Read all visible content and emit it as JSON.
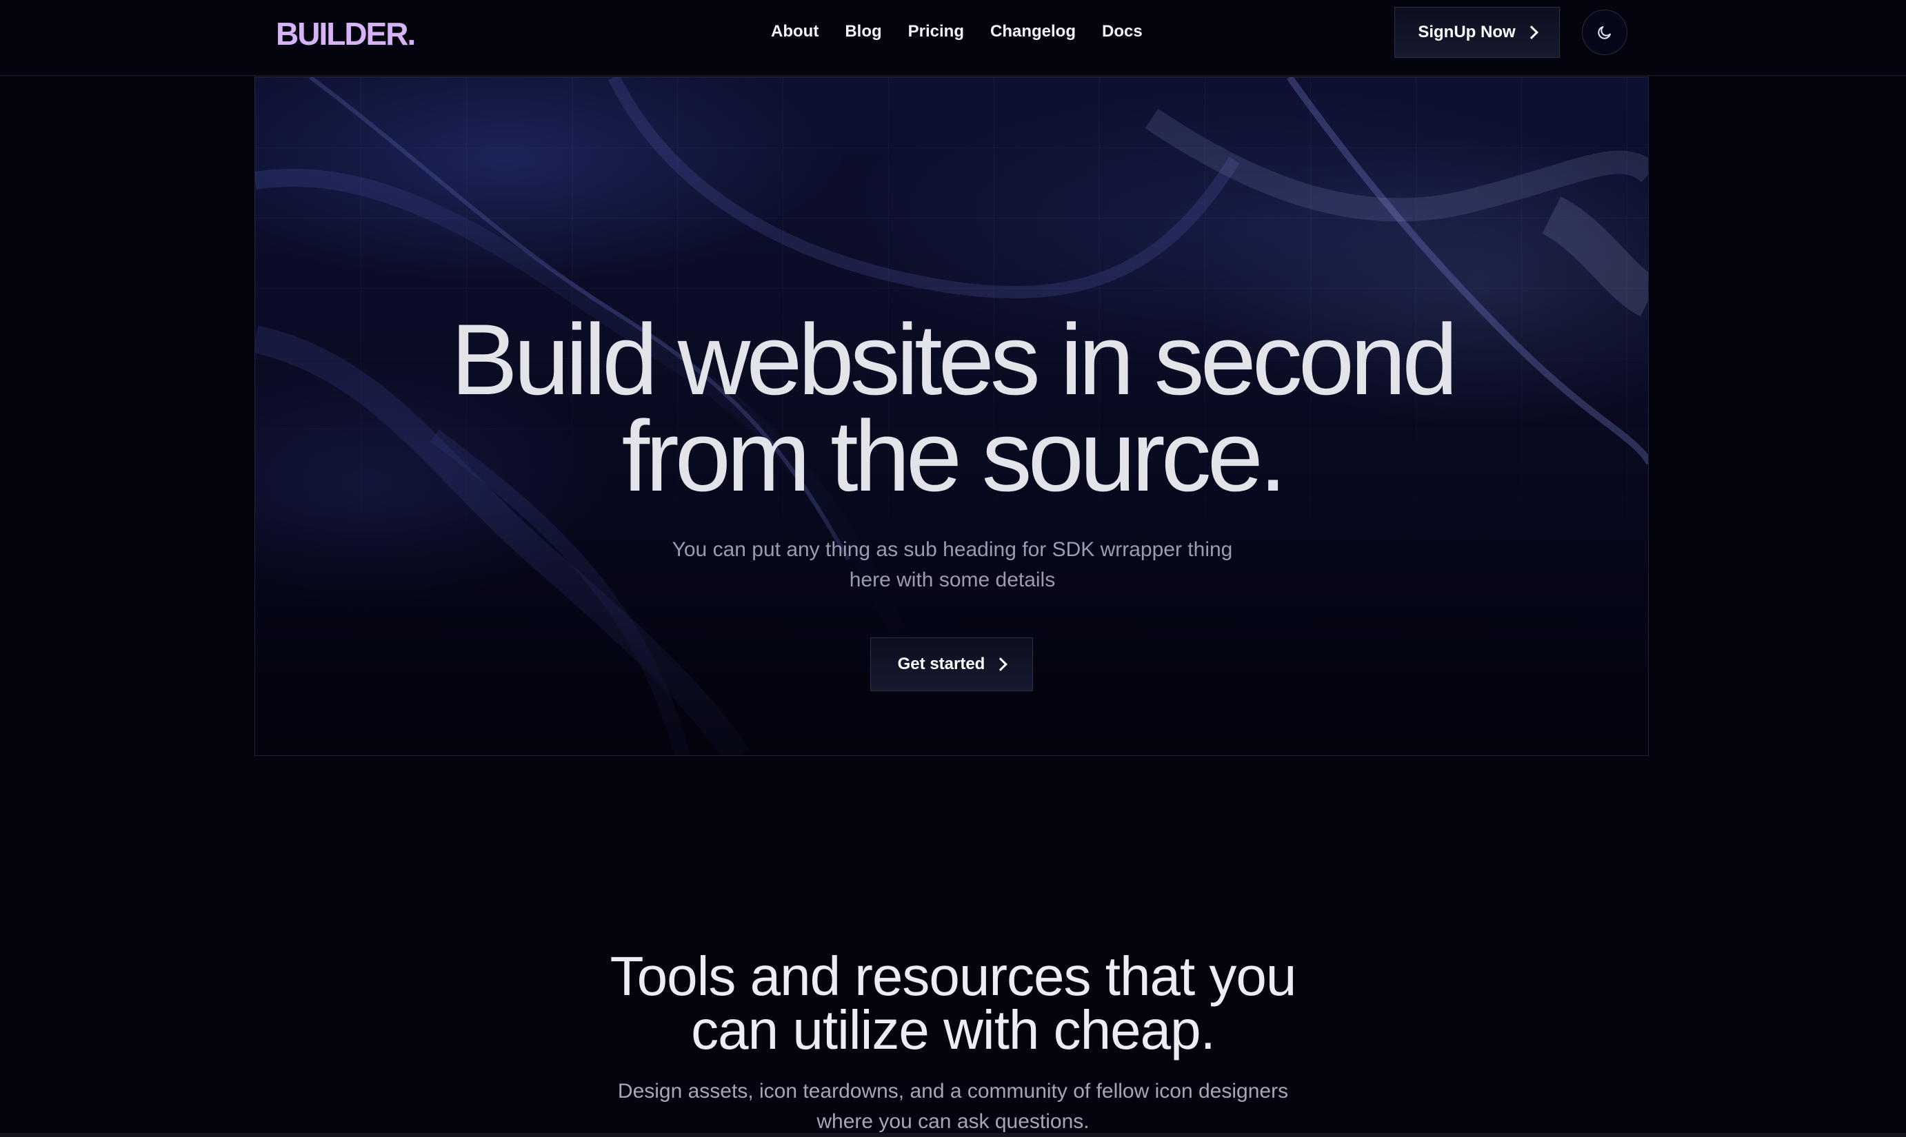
{
  "nav": {
    "logo": "BUILDER.",
    "links": [
      "About",
      "Blog",
      "Pricing",
      "Changelog",
      "Docs"
    ],
    "signup_label": "SignUp Now",
    "theme_toggle_icon": "moon-icon"
  },
  "hero": {
    "title_line1": "Build websites in second",
    "title_line2": "from the source.",
    "subtitle_line1": "You can put any thing as sub heading for SDK wrrapper thing",
    "subtitle_line2": "here with some details",
    "cta_label": "Get started"
  },
  "tools": {
    "title_line1": "Tools and resources that you",
    "title_line2": "can utilize with cheap.",
    "subtitle_line1": "Design assets, icon teardowns, and a community of fellow icon designers",
    "subtitle_line2": "where you can ask questions."
  },
  "colors": {
    "background": "#04040f",
    "logo": "#d6b3f5",
    "button_border": "#2c2f44",
    "subtitle": "#9c9cb0"
  }
}
